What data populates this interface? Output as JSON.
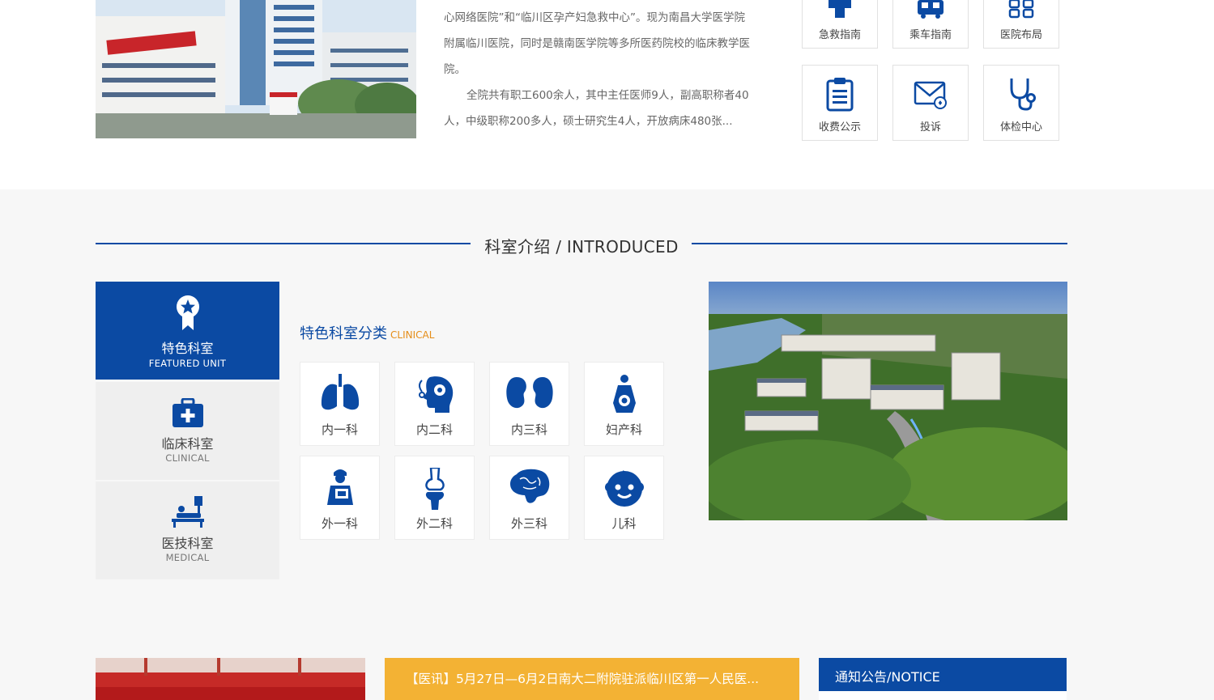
{
  "intro": {
    "lines": [
      "心网络医院”和“临川区孕产妇急救中心”。现为南昌大学医学院",
      "附属临川医院，同时是赣南医学院等多所医药院校的临床教学医",
      "院。",
      "全院共有职工600余人，其中主任医师9人，副高职称者40",
      "人，中级职称200多人，硕士研究生4人，开放病床480张..."
    ]
  },
  "quick_links": [
    {
      "label": "急救指南",
      "icon": "first-aid-cross-icon"
    },
    {
      "label": "乘车指南",
      "icon": "bus-icon"
    },
    {
      "label": "医院布局",
      "icon": "layout-grid-icon"
    },
    {
      "label": "收费公示",
      "icon": "clipboard-icon"
    },
    {
      "label": "投诉",
      "icon": "mail-icon"
    },
    {
      "label": "体检中心",
      "icon": "stethoscope-icon"
    }
  ],
  "section": {
    "title": "科室介绍 / INTRODUCED"
  },
  "tabs": [
    {
      "name": "特色科室",
      "sub": "FEATURED UNIT",
      "icon": "award-ribbon-icon",
      "active": true
    },
    {
      "name": "临床科室",
      "sub": "CLINICAL",
      "icon": "medical-kit-icon",
      "active": false
    },
    {
      "name": "医技科室",
      "sub": "MEDICAL",
      "icon": "patient-bed-icon",
      "active": false
    }
  ],
  "category": {
    "title": "特色科室分类",
    "title_en": "CLINICAL"
  },
  "departments": [
    {
      "label": "内一科",
      "icon": "lungs-icon"
    },
    {
      "label": "内二科",
      "icon": "brain-head-icon"
    },
    {
      "label": "内三科",
      "icon": "kidneys-icon"
    },
    {
      "label": "妇产科",
      "icon": "pregnant-icon"
    },
    {
      "label": "外一科",
      "icon": "surgeon-icon"
    },
    {
      "label": "外二科",
      "icon": "bone-joint-icon"
    },
    {
      "label": "外三科",
      "icon": "brain-icon"
    },
    {
      "label": "儿科",
      "icon": "baby-face-icon"
    }
  ],
  "news": {
    "headline": "【医讯】5月27日—6月2日南大二附院驻派临川区第一人民医..."
  },
  "notice": {
    "title": "通知公告/NOTICE"
  },
  "colors": {
    "brand_blue": "#0b4aa3",
    "accent_orange": "#e58d18",
    "news_yellow": "#f3b234",
    "section_bg": "#f7f7f7"
  }
}
